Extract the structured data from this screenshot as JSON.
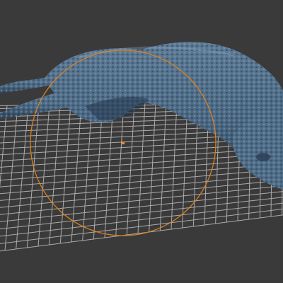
{
  "viewport": {
    "background": "#3a3a3a",
    "grid_color": "#c8c8c8",
    "model_color": "#4f6d88",
    "model_shadow": "#2c3e52",
    "model_highlight": "#7f9ab3",
    "brush_color": "#d9801f",
    "brush_pivot_color": "#f08a24"
  },
  "scene": {
    "model_name": "",
    "tool": "sculpt-brush",
    "icons": [
      "brush-cursor-icon",
      "brush-pivot-icon"
    ]
  }
}
